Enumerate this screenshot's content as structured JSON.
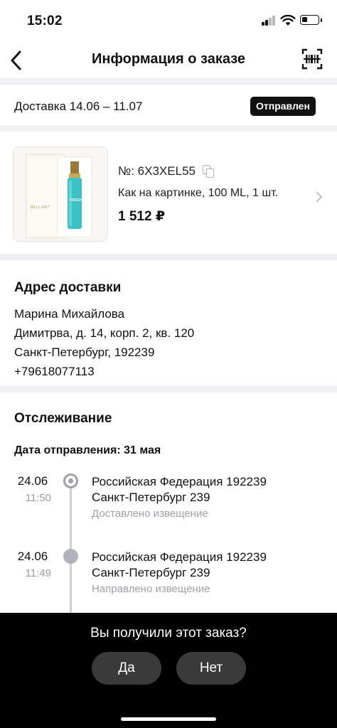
{
  "status_bar": {
    "time": "15:02"
  },
  "header": {
    "title": "Информация о заказе"
  },
  "delivery": {
    "text": "Доставка 14.06 – 11.07",
    "status": "Отправлен"
  },
  "product": {
    "order_number": "№: 6X3XEL55",
    "description": "Как на картинке, 100 ML, 1 шт.",
    "price": "1 512 ₽",
    "image_brand": "BELL ART",
    "image_label": "FRESH"
  },
  "address": {
    "title": "Адрес доставки",
    "name": "Марина Михайлова",
    "street": "Димитрва, д. 14, корп. 2, кв. 120",
    "city": "Санкт-Петербург, 192239",
    "phone": "+79618077113"
  },
  "tracking": {
    "title": "Отслеживание",
    "ship_date": "Дата отправления: 31 мая",
    "events": [
      {
        "date": "24.06",
        "time": "11:50",
        "line1": "Российская Федерация 192239",
        "line2": "Санкт-Петербург 239",
        "status": "Доставлено извещение"
      },
      {
        "date": "24.06",
        "time": "11:49",
        "line1": "Российская Федерация 192239",
        "line2": "Санкт-Петербург 239",
        "status": "Направлено извещение"
      }
    ]
  },
  "prompt": {
    "question": "Вы получили этот заказ?",
    "yes": "Да",
    "no": "Нет"
  },
  "colors": {
    "accent": "#111111",
    "muted": "#a0a0a8",
    "sheet": "#000000",
    "button": "#3a3a3a"
  }
}
